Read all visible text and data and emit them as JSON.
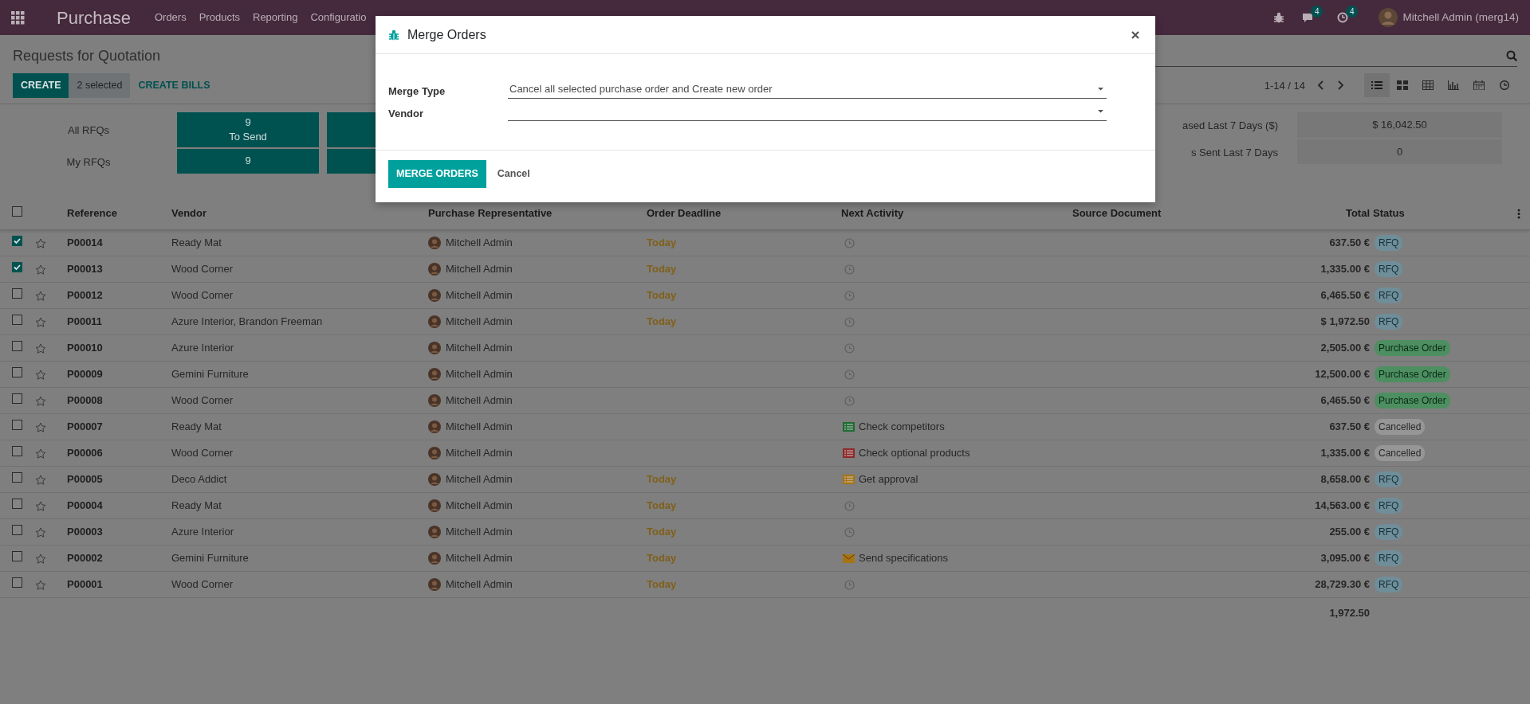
{
  "app": {
    "title": "Purchase"
  },
  "menu": [
    {
      "label": "Orders"
    },
    {
      "label": "Products"
    },
    {
      "label": "Reporting"
    },
    {
      "label": "Configuratio"
    }
  ],
  "systray": {
    "messages_count": "4",
    "activities_count": "4",
    "user": "Mitchell Admin (merg14)"
  },
  "control_panel": {
    "title": "Requests for Quotation",
    "buttons": [
      {
        "label": "CREATE",
        "kind": "primary"
      },
      {
        "label": "2 selected",
        "kind": "counter"
      },
      {
        "label": "CREATE BILLS",
        "kind": "link"
      }
    ],
    "pager": "1-14 / 14",
    "views": [
      {
        "kind": "list",
        "selected": true
      },
      {
        "kind": "kanban",
        "selected": false
      },
      {
        "kind": "pivot",
        "selected": false
      },
      {
        "kind": "graph",
        "selected": false
      },
      {
        "kind": "calendar",
        "selected": false
      },
      {
        "kind": "activity",
        "selected": false
      }
    ]
  },
  "dashboard": {
    "left": [
      {
        "label": "All RFQs",
        "value": "9",
        "caption": "To Send"
      },
      {
        "label": "My RFQs",
        "value": "9"
      }
    ],
    "right": [
      {
        "label": "ased Last 7 Days ($)",
        "value": "$ 16,042.50"
      },
      {
        "label": "s Sent Last 7 Days",
        "value": "0"
      }
    ]
  },
  "table": {
    "all_selected": false,
    "columns": [
      "Reference",
      "Vendor",
      "Purchase Representative",
      "Order Deadline",
      "Next Activity",
      "Source Document",
      "Total",
      "Status"
    ],
    "rows": [
      {
        "selected": true,
        "reference": "P00014",
        "vendor": "Ready Mat",
        "representative": "Mitchell Admin",
        "deadline": "Today",
        "activity": {
          "kind": "none"
        },
        "total": "637.50 €",
        "status": {
          "label": "RFQ",
          "kind": "rfq"
        }
      },
      {
        "selected": true,
        "reference": "P00013",
        "vendor": "Wood Corner",
        "representative": "Mitchell Admin",
        "deadline": "Today",
        "activity": {
          "kind": "none"
        },
        "total": "1,335.00 €",
        "status": {
          "label": "RFQ",
          "kind": "rfq"
        }
      },
      {
        "selected": false,
        "reference": "P00012",
        "vendor": "Wood Corner",
        "representative": "Mitchell Admin",
        "deadline": "Today",
        "activity": {
          "kind": "none"
        },
        "total": "6,465.50 €",
        "status": {
          "label": "RFQ",
          "kind": "rfq"
        }
      },
      {
        "selected": false,
        "reference": "P00011",
        "vendor": "Azure Interior, Brandon Freeman",
        "representative": "Mitchell Admin",
        "deadline": "Today",
        "activity": {
          "kind": "none"
        },
        "total": "$ 1,972.50",
        "status": {
          "label": "RFQ",
          "kind": "rfq"
        }
      },
      {
        "selected": false,
        "reference": "P00010",
        "vendor": "Azure Interior",
        "representative": "Mitchell Admin",
        "activity": {
          "kind": "none"
        },
        "total": "2,505.00 €",
        "status": {
          "label": "Purchase Order",
          "kind": "purchase"
        }
      },
      {
        "selected": false,
        "reference": "P00009",
        "vendor": "Gemini Furniture",
        "representative": "Mitchell Admin",
        "activity": {
          "kind": "none"
        },
        "total": "12,500.00 €",
        "status": {
          "label": "Purchase Order",
          "kind": "purchase"
        }
      },
      {
        "selected": false,
        "reference": "P00008",
        "vendor": "Wood Corner",
        "representative": "Mitchell Admin",
        "activity": {
          "kind": "none"
        },
        "total": "6,465.50 €",
        "status": {
          "label": "Purchase Order",
          "kind": "purchase"
        }
      },
      {
        "selected": false,
        "reference": "P00007",
        "vendor": "Ready Mat",
        "representative": "Mitchell Admin",
        "activity": {
          "kind": "todo",
          "color": "#1e6b32",
          "text": "Check competitors"
        },
        "total": "637.50 €",
        "status": {
          "label": "Cancelled",
          "kind": "cancelled"
        }
      },
      {
        "selected": false,
        "reference": "P00006",
        "vendor": "Wood Corner",
        "representative": "Mitchell Admin",
        "activity": {
          "kind": "todo",
          "color": "#8e2a2a",
          "text": "Check optional products"
        },
        "total": "1,335.00 €",
        "status": {
          "label": "Cancelled",
          "kind": "cancelled"
        }
      },
      {
        "selected": false,
        "reference": "P00005",
        "vendor": "Deco Addict",
        "representative": "Mitchell Admin",
        "deadline": "Today",
        "activity": {
          "kind": "todo",
          "color": "#a77414",
          "text": "Get approval"
        },
        "total": "8,658.00 €",
        "status": {
          "label": "RFQ",
          "kind": "rfq"
        }
      },
      {
        "selected": false,
        "reference": "P00004",
        "vendor": "Ready Mat",
        "representative": "Mitchell Admin",
        "deadline": "Today",
        "activity": {
          "kind": "none"
        },
        "total": "14,563.00 €",
        "status": {
          "label": "RFQ",
          "kind": "rfq"
        }
      },
      {
        "selected": false,
        "reference": "P00003",
        "vendor": "Azure Interior",
        "representative": "Mitchell Admin",
        "deadline": "Today",
        "activity": {
          "kind": "none"
        },
        "total": "255.00 €",
        "status": {
          "label": "RFQ",
          "kind": "rfq"
        }
      },
      {
        "selected": false,
        "reference": "P00002",
        "vendor": "Gemini Furniture",
        "representative": "Mitchell Admin",
        "deadline": "Today",
        "activity": {
          "kind": "email",
          "color": "#a77414",
          "text": "Send specifications"
        },
        "total": "3,095.00 €",
        "status": {
          "label": "RFQ",
          "kind": "rfq"
        }
      },
      {
        "selected": false,
        "reference": "P00001",
        "vendor": "Wood Corner",
        "representative": "Mitchell Admin",
        "deadline": "Today",
        "activity": {
          "kind": "none"
        },
        "total": "28,729.30 €",
        "status": {
          "label": "RFQ",
          "kind": "rfq"
        }
      }
    ],
    "sum_total": "1,972.50"
  },
  "dialog": {
    "title": "Merge Orders",
    "fields": [
      {
        "label": "Merge Type",
        "value": "Cancel all selected purchase order and Create new order"
      },
      {
        "label": "Vendor"
      }
    ],
    "buttons": [
      {
        "label": "MERGE ORDERS",
        "kind": "primary"
      },
      {
        "label": "Cancel",
        "kind": "secondary"
      }
    ]
  }
}
